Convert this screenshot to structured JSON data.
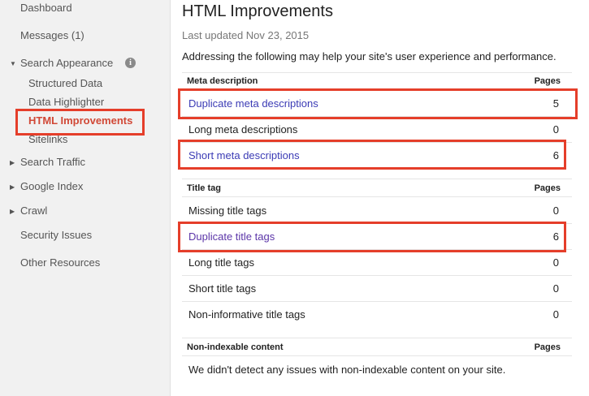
{
  "sidebar": {
    "dashboard": "Dashboard",
    "messages": "Messages (1)",
    "search_appearance": "Search Appearance",
    "sub_items": [
      "Structured Data",
      "Data Highlighter",
      "HTML Improvements",
      "Sitelinks"
    ],
    "search_traffic": "Search Traffic",
    "google_index": "Google Index",
    "crawl": "Crawl",
    "security_issues": "Security Issues",
    "other_resources": "Other Resources",
    "info_glyph": "i"
  },
  "main": {
    "title": "HTML Improvements",
    "last_updated": "Last updated Nov 23, 2015",
    "intro": "Addressing the following may help your site's user experience and performance.",
    "meta": {
      "header": "Meta description",
      "pages_label": "Pages",
      "rows": [
        {
          "label": "Duplicate meta descriptions",
          "value": "5"
        },
        {
          "label": "Long meta descriptions",
          "value": "0"
        },
        {
          "label": "Short meta descriptions",
          "value": "6"
        }
      ]
    },
    "title_tag": {
      "header": "Title tag",
      "pages_label": "Pages",
      "rows": [
        {
          "label": "Missing title tags",
          "value": "0"
        },
        {
          "label": "Duplicate title tags",
          "value": "6"
        },
        {
          "label": "Long title tags",
          "value": "0"
        },
        {
          "label": "Short title tags",
          "value": "0"
        },
        {
          "label": "Non-informative title tags",
          "value": "0"
        }
      ]
    },
    "nonindex": {
      "header": "Non-indexable content",
      "pages_label": "Pages",
      "message": "We didn't detect any issues with non-indexable content on your site."
    }
  },
  "colors": {
    "highlight": "#e53e2a",
    "active_nav": "#d14836",
    "link": "#3b3bb5",
    "visited_link": "#5b35a8"
  }
}
